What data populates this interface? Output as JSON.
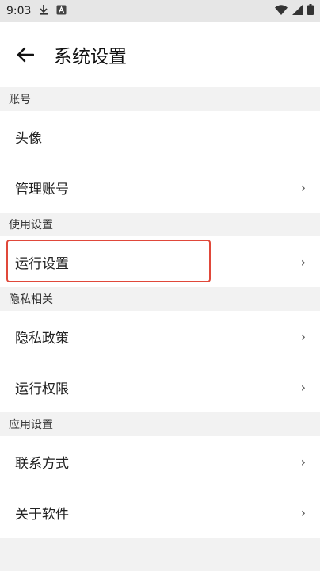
{
  "status_bar": {
    "time": "9:03",
    "icons_left": [
      "download-icon",
      "app-a-icon"
    ],
    "icons_right": [
      "wifi-icon",
      "signal-icon",
      "battery-icon"
    ]
  },
  "app_bar": {
    "back_icon": "arrow-left-icon",
    "title": "系统设置"
  },
  "sections": [
    {
      "header": "账号",
      "items": [
        {
          "label": "头像",
          "chevron": false
        },
        {
          "label": "管理账号",
          "chevron": true
        }
      ]
    },
    {
      "header": "使用设置",
      "items": [
        {
          "label": "运行设置",
          "chevron": true,
          "highlighted": true
        }
      ]
    },
    {
      "header": "隐私相关",
      "items": [
        {
          "label": "隐私政策",
          "chevron": true
        },
        {
          "label": "运行权限",
          "chevron": true
        }
      ]
    },
    {
      "header": "应用设置",
      "items": [
        {
          "label": "联系方式",
          "chevron": true
        },
        {
          "label": "关于软件",
          "chevron": true
        }
      ]
    }
  ],
  "chevron_glyph": "›",
  "colors": {
    "highlight": "#e0483a",
    "page_bg": "#f2f2f2",
    "status_bg": "#e6e6e6"
  }
}
